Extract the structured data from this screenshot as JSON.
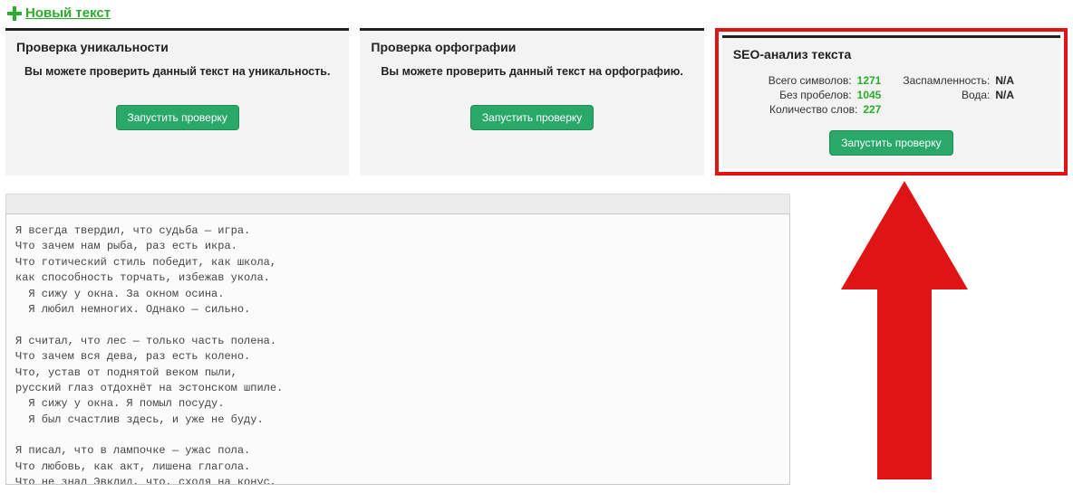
{
  "top": {
    "new_text_label": "Новый текст"
  },
  "panels": {
    "uniq": {
      "title": "Проверка уникальности",
      "desc": "Вы можете проверить данный текст на уникальность.",
      "button": "Запустить проверку"
    },
    "spell": {
      "title": "Проверка орфографии",
      "desc": "Вы можете проверить данный текст на орфографию.",
      "button": "Запустить проверку"
    },
    "seo": {
      "title": "SEO-анализ текста",
      "button": "Запустить проверку",
      "stats_left": [
        {
          "label": "Всего символов:",
          "value": "1271"
        },
        {
          "label": "Без пробелов:",
          "value": "1045"
        },
        {
          "label": "Количество слов:",
          "value": "227"
        }
      ],
      "stats_right": [
        {
          "label": "Заспамленность:",
          "value": "N/A"
        },
        {
          "label": "Вода:",
          "value": "N/A"
        }
      ]
    }
  },
  "editor": {
    "text": "Я всегда твердил, что судьба — игра.\nЧто зачем нам рыба, раз есть икра.\nЧто готический стиль победит, как школа,\nкак способность торчать, избежав укола.\n  Я сижу у окна. За окном осина.\n  Я любил немногих. Однако — сильно.\n\nЯ считал, что лес — только часть полена.\nЧто зачем вся дева, раз есть колено.\nЧто, устав от поднятой веком пыли,\nрусский глаз отдохнёт на эстонском шпиле.\n  Я сижу у окна. Я помыл посуду.\n  Я был счастлив здесь, и уже не буду.\n\nЯ писал, что в лампочке — ужас пола.\nЧто любовь, как акт, лишена глагола.\nЧто не знал Эвклид, что, сходя на конус,\nвещь обретает не ноль, но Хронос.\n  Я сижу у окна. Вспоминаю юность.\n  Улыбнусь порою, порой отплюнусь."
  },
  "colors": {
    "accent_green": "#29a869",
    "highlight_red": "#e01414"
  }
}
